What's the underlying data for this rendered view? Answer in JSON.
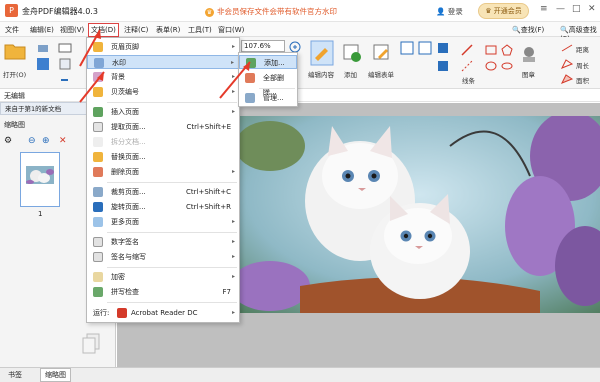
{
  "app": {
    "title": "金舟PDF编辑器4.0.3",
    "logo_letter": "P"
  },
  "notice": {
    "text": "非会员保存文件会带有软件官方水印"
  },
  "account": {
    "login": "登录",
    "vip_button": "开通会员"
  },
  "menubar": {
    "items": [
      "文件",
      "编辑(E)",
      "视图(V)",
      "文档(D)",
      "注释(C)",
      "表单(R)",
      "工具(T)",
      "窗口(W)"
    ],
    "find": "查找(F)",
    "advanced_find": "高级查找(S)"
  },
  "ribbon": {
    "open_label": "打开(O)",
    "zoom_value": "107.6%",
    "edit_content": "编辑内容",
    "add": "添加",
    "edit_form": "编辑表单",
    "line": "线条",
    "stamp": "图章",
    "distance": "距离",
    "perimeter": "周长",
    "area": "面积",
    "colors": {
      "accent": "#2a6ebb",
      "danger": "#d43a2a"
    }
  },
  "toolbar2": {
    "text": "无编辑"
  },
  "doc_tab": {
    "label": "来自于第1的新文档"
  },
  "left_panel": {
    "title": "缩略图",
    "page_number": "1"
  },
  "bottom_tabs": [
    "书签",
    "缩略图"
  ],
  "document_menu": {
    "items": [
      {
        "label": "页眉页脚",
        "arrow": "▸"
      },
      {
        "label": "水印",
        "arrow": "▸",
        "highlighted": true
      },
      {
        "label": "背景",
        "arrow": "▸"
      },
      {
        "label": "贝茨编号",
        "arrow": "▸"
      },
      {
        "label": "插入页面",
        "arrow": "▸"
      },
      {
        "label": "提取页面...",
        "shortcut": "Ctrl+Shift+E"
      },
      {
        "label": "拆分文档...",
        "disabled": true
      },
      {
        "label": "替换页面..."
      },
      {
        "label": "删除页面",
        "arrow": "▸"
      },
      {
        "label": "裁剪页面...",
        "shortcut": "Ctrl+Shift+C"
      },
      {
        "label": "旋转页面...",
        "shortcut": "Ctrl+Shift+R"
      },
      {
        "label": "更多页面",
        "arrow": "▸"
      },
      {
        "label": "数字签名",
        "arrow": "▸"
      },
      {
        "label": "签名与缩写",
        "arrow": "▸"
      },
      {
        "label": "加密",
        "arrow": "▸"
      },
      {
        "label": "拼写检查",
        "shortcut": "F7"
      },
      {
        "label": "运行:",
        "app": "Acrobat Reader DC",
        "arrow": "▸"
      }
    ]
  },
  "watermark_submenu": {
    "items": [
      {
        "label": "添加...",
        "highlighted": true
      },
      {
        "label": "全部删除..."
      },
      {
        "label": "管理..."
      }
    ]
  }
}
